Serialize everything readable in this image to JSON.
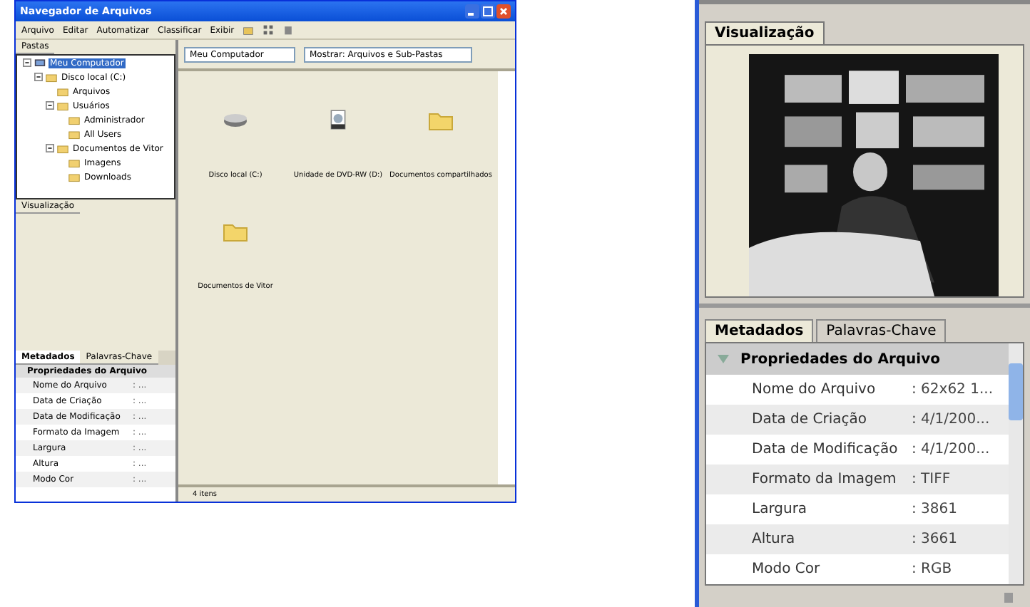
{
  "file_browser": {
    "title": "Navegador de Arquivos",
    "menu": [
      "Arquivo",
      "Editar",
      "Automatizar",
      "Classificar",
      "Exibir"
    ],
    "folders_tab": "Pastas",
    "tree": [
      {
        "label": "Meu Computador",
        "selected": true,
        "expanded": true,
        "children": [
          {
            "label": "Disco local (C:)",
            "selected": false,
            "expanded": true,
            "children": [
              {
                "label": "Arquivos",
                "selected": false
              },
              {
                "label": "Usuários",
                "selected": false,
                "expanded": true,
                "children": [
                  {
                    "label": "Administrador",
                    "selected": false
                  },
                  {
                    "label": "All Users",
                    "selected": false
                  }
                ]
              },
              {
                "label": "Documentos de Vitor",
                "selected": false,
                "expanded": true,
                "children": [
                  {
                    "label": "Imagens",
                    "selected": false
                  },
                  {
                    "label": "Downloads",
                    "selected": false
                  }
                ]
              }
            ]
          }
        ]
      }
    ],
    "preview_tab": "Visualização",
    "metadata_tabs": [
      {
        "label": "Metadados",
        "selected": true
      },
      {
        "label": "Palavras-Chave",
        "selected": false
      }
    ],
    "metadata_section": "Propriedades do Arquivo",
    "metadata_rows": [
      {
        "label": "Nome do Arquivo",
        "value": ": ..."
      },
      {
        "label": "Data de Criação",
        "value": ": ..."
      },
      {
        "label": "Data de Modificação",
        "value": ": ..."
      },
      {
        "label": "Formato da Imagem",
        "value": ": ..."
      },
      {
        "label": "Largura",
        "value": ": ..."
      },
      {
        "label": "Altura",
        "value": ": ..."
      },
      {
        "label": "Modo Cor",
        "value": ": ..."
      }
    ],
    "location": "Meu Computador",
    "filter": "Mostrar: Arquivos e Sub-Pastas",
    "items": [
      {
        "name": "Disco local (C:)",
        "kind": "drive"
      },
      {
        "name": "Unidade de DVD-RW (D:)",
        "kind": "disc"
      },
      {
        "name": "Documentos compartilhados",
        "kind": "folder"
      },
      {
        "name": "Documentos de Vitor",
        "kind": "folder"
      }
    ],
    "status": "4 itens"
  },
  "panel": {
    "preview_tab": "Visualização",
    "tabs": [
      {
        "label": "Metadados",
        "selected": true
      },
      {
        "label": "Palavras-Chave",
        "selected": false
      }
    ],
    "section": {
      "title": "Propriedades do Arquivo",
      "expanded": true
    },
    "rows": [
      {
        "label": "Nome do Arquivo",
        "value": ": 62x62 1..."
      },
      {
        "label": "Data de Criação",
        "value": ": 4/1/200..."
      },
      {
        "label": "Data de Modificação",
        "value": ": 4/1/200..."
      },
      {
        "label": "Formato da Imagem",
        "value": ": TIFF"
      },
      {
        "label": "Largura",
        "value": ": 3861"
      },
      {
        "label": "Altura",
        "value": ": 3661"
      },
      {
        "label": "Modo Cor",
        "value": ": RGB"
      }
    ]
  }
}
